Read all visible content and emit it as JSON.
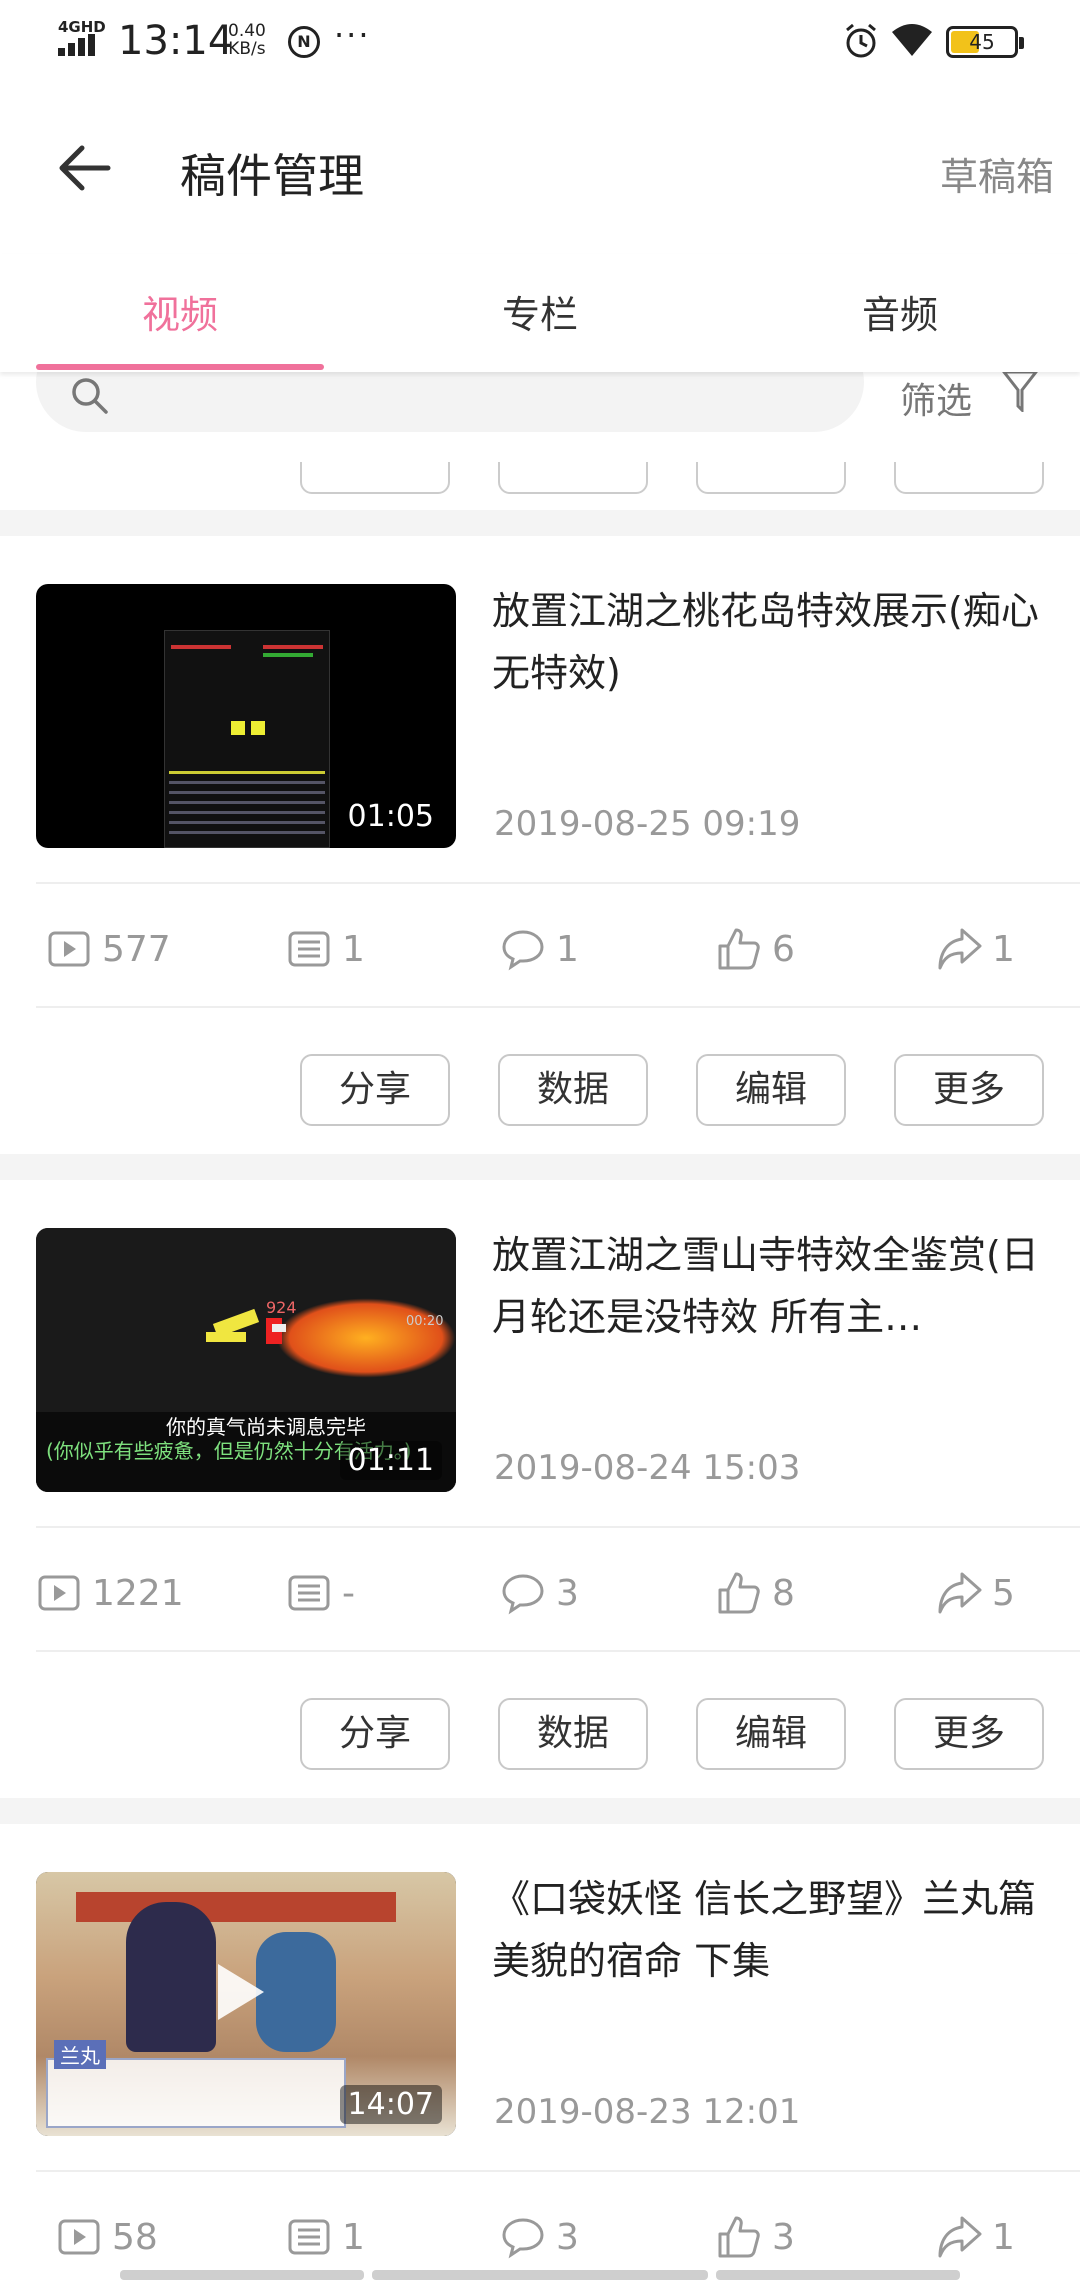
{
  "status_bar": {
    "network": "4GHD",
    "time": "13:14",
    "speed_value": "0.40",
    "speed_unit": "KB/s",
    "circle_icon_label": "N",
    "more": "···",
    "battery": "45",
    "icons": [
      "signal-icon",
      "alarm-icon",
      "wifi-icon",
      "battery-icon"
    ]
  },
  "header": {
    "back_icon": "arrow-left-icon",
    "title": "稿件管理",
    "drafts_label": "草稿箱"
  },
  "tabs": [
    {
      "label": "视频",
      "active": true
    },
    {
      "label": "专栏",
      "active": false
    },
    {
      "label": "音频",
      "active": false
    }
  ],
  "search": {
    "filter_label": "筛选"
  },
  "accent_color": "#f0719b",
  "actions": [
    "分享",
    "数据",
    "编辑",
    "更多"
  ],
  "videos": [
    {
      "title": "放置江湖之桃花岛特效展示(痴心无特效)",
      "date": "2019-08-25 09:19",
      "duration": "01:05",
      "plays": "577",
      "danmaku": "1",
      "comments": "1",
      "likes": "6",
      "shares": "1"
    },
    {
      "title": "放置江湖之雪山寺特效全鉴赏(日月轮还是没特效 所有主…",
      "date": "2019-08-24 15:03",
      "duration": "01:11",
      "plays": "1221",
      "danmaku": "-",
      "comments": "3",
      "likes": "8",
      "shares": "5",
      "thumb_text_1": "你的真气尚未调息完毕",
      "thumb_text_2": "(你似乎有些疲惫，但是仍然十分有活力。)"
    },
    {
      "title": "《口袋妖怪 信长之野望》兰丸篇美貌的宿命 下集",
      "date": "2019-08-23 12:01",
      "duration": "14:07",
      "plays": "58",
      "danmaku": "1",
      "comments": "3",
      "likes": "3",
      "shares": "1",
      "thumb_name": "兰丸"
    }
  ]
}
